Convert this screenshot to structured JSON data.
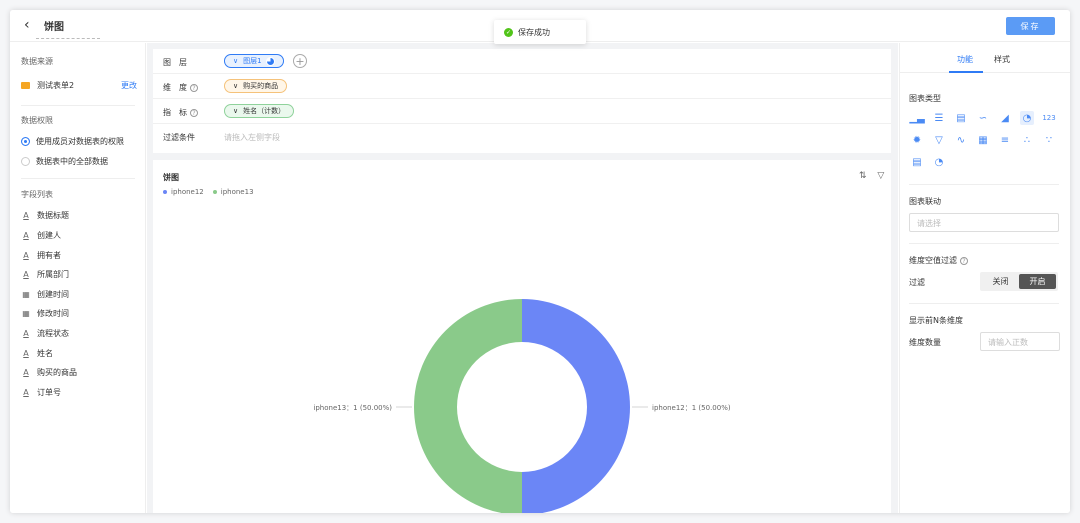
{
  "header": {
    "back_icon": "chevron-left-icon",
    "title": "饼图",
    "save_label": "保存"
  },
  "toast": {
    "text": "保存成功",
    "icon": "check-circle-icon",
    "color": "#52c41a"
  },
  "left_panel": {
    "source_title": "数据来源",
    "source_name": "测试表单2",
    "source_change": "更改",
    "perm_title": "数据权限",
    "perm_options": [
      {
        "label": "使用成员对数据表的权限",
        "selected": true
      },
      {
        "label": "数据表中的全部数据",
        "selected": false
      }
    ],
    "fields_title": "字段列表",
    "fields": [
      {
        "icon": "text-field-icon",
        "label": "数据标题"
      },
      {
        "icon": "text-field-icon",
        "label": "创建人"
      },
      {
        "icon": "text-field-icon",
        "label": "拥有者"
      },
      {
        "icon": "text-field-icon",
        "label": "所属部门"
      },
      {
        "icon": "calendar-icon",
        "label": "创建时间"
      },
      {
        "icon": "calendar-icon",
        "label": "修改时间"
      },
      {
        "icon": "text-field-icon",
        "label": "流程状态"
      },
      {
        "icon": "text-field-icon",
        "label": "姓名"
      },
      {
        "icon": "text-field-icon",
        "label": "购买的商品"
      },
      {
        "icon": "text-field-icon",
        "label": "订单号"
      }
    ]
  },
  "config": {
    "layer_label": "图　层",
    "layer_value": "图层1",
    "dimension_label": "维　度",
    "dimension_value": "购买的商品",
    "metric_label": "指　标",
    "metric_value": "姓名（计数）",
    "filter_label": "过滤条件",
    "filter_placeholder": "请拖入左侧字段"
  },
  "chart_card": {
    "title": "饼图",
    "sort_icon": "sort-icon",
    "filter_icon": "filter-icon"
  },
  "chart_data": {
    "type": "pie",
    "donut": true,
    "categories": [
      "iphone12",
      "iphone13"
    ],
    "values": [
      1,
      1
    ],
    "colors": [
      "#6b86f6",
      "#8aca8a"
    ],
    "labels": [
      "iphone12：1 (50.00%)",
      "iphone13：1 (50.00%)"
    ],
    "legend": "top-left"
  },
  "right_panel": {
    "tab_function": "功能",
    "tab_style": "样式",
    "chart_type_title": "图表类型",
    "chart_types": [
      "bar-chart-icon",
      "horizontal-bar-icon",
      "stacked-bar-icon",
      "line-chart-icon",
      "area-chart-icon",
      "pie-chart-icon",
      "number-card-icon",
      "radar-icon",
      "funnel-icon",
      "combo-chart-icon",
      "table-icon",
      "list-icon",
      "scatter-icon",
      "bubble-icon",
      "indicator-card-icon",
      "gauge-icon"
    ],
    "chart_type_selected": 5,
    "link_title": "图表联动",
    "link_placeholder": "请选择",
    "null_filter_title": "维度空值过滤",
    "filter_label": "过滤",
    "toggle_off": "关闭",
    "toggle_on": "开启",
    "topn_title": "显示前N条维度",
    "dim_count_label": "维度数量",
    "dim_count_placeholder": "请输入正数"
  }
}
